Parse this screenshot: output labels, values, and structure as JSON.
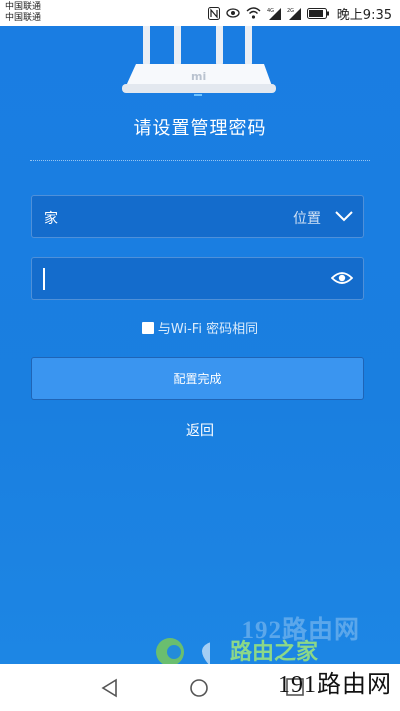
{
  "status_bar": {
    "carrier_1": "中国联通",
    "carrier_2": "中国联通",
    "time": "晚上9:35",
    "icons": [
      "nfc-icon",
      "eye-comfort-icon",
      "wifi-icon",
      "signal-4g-icon",
      "signal-2g-icon",
      "battery-icon"
    ]
  },
  "page": {
    "title": "请设置管理密码",
    "location_select": {
      "value": "家",
      "label": "位置"
    },
    "password_input": {
      "value": "",
      "placeholder": ""
    },
    "same_as_wifi_checkbox": {
      "label": "与Wi-Fi 密码相同",
      "checked": false
    },
    "confirm_button_label": "配置完成",
    "back_link_label": "返回"
  },
  "watermarks": {
    "top": "192路由网",
    "middle": "路由之家",
    "bottom": "191路由网"
  },
  "colors": {
    "background": "#1a7fe0",
    "button": "#3a95f0"
  }
}
